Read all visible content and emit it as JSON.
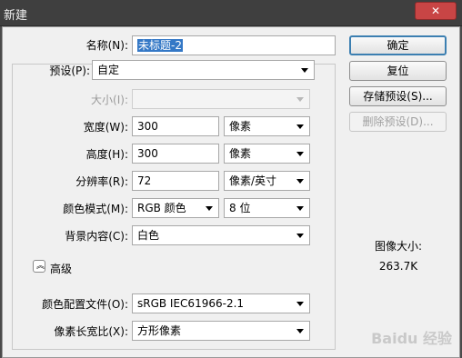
{
  "window": {
    "title": "新建",
    "close_glyph": "✕"
  },
  "form": {
    "name_label": "名称(N):",
    "name_value": "未标题-2",
    "preset_label": "预设(P):",
    "preset_value": "自定",
    "size_label": "大小(I):",
    "size_value": "",
    "width_label": "宽度(W):",
    "width_value": "300",
    "width_unit": "像素",
    "height_label": "高度(H):",
    "height_value": "300",
    "height_unit": "像素",
    "resolution_label": "分辨率(R):",
    "resolution_value": "72",
    "resolution_unit": "像素/英寸",
    "color_mode_label": "颜色模式(M):",
    "color_mode_value": "RGB 颜色",
    "bit_depth": "8 位",
    "background_label": "背景内容(C):",
    "background_value": "白色",
    "advanced_label": "高级",
    "color_profile_label": "颜色配置文件(O):",
    "color_profile_value": "sRGB IEC61966-2.1",
    "pixel_aspect_label": "像素长宽比(X):",
    "pixel_aspect_value": "方形像素"
  },
  "buttons": {
    "ok": "确定",
    "reset": "复位",
    "save_preset": "存储预设(S)...",
    "delete_preset": "删除预设(D)..."
  },
  "image_size": {
    "label": "图像大小:",
    "value": "263.7K"
  },
  "watermark": "Baidu 经验",
  "colors": {
    "selection": "#3478c6",
    "default_button_border": "#3c7fb1"
  }
}
